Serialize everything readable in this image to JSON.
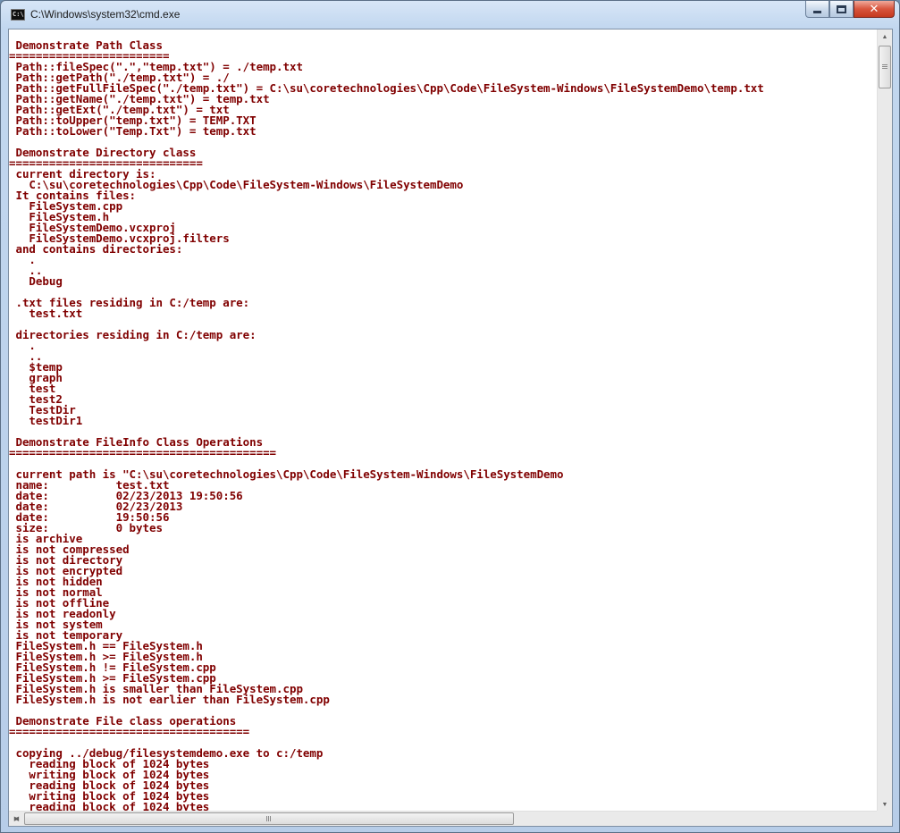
{
  "window": {
    "title": "C:\\Windows\\system32\\cmd.exe",
    "icon": "cmd-icon",
    "icon_text": "C:\\"
  },
  "caption_buttons": {
    "minimize": "minimize-icon",
    "maximize": "maximize-icon",
    "close": "close-icon",
    "close_glyph": "✕"
  },
  "scrollbar": {
    "up_glyph": "▲",
    "down_glyph": "▼",
    "left_glyph": "◀",
    "right_glyph": "▶"
  },
  "console": {
    "text_color": "#800000",
    "background": "#ffffff",
    "lines": [
      " Demonstrate Path Class",
      "========================",
      " Path::fileSpec(\".\",\"temp.txt\") = ./temp.txt",
      " Path::getPath(\"./temp.txt\") = ./",
      " Path::getFullFileSpec(\"./temp.txt\") = C:\\su\\coretechnologies\\Cpp\\Code\\FileSystem-Windows\\FileSystemDemo\\temp.txt",
      " Path::getName(\"./temp.txt\") = temp.txt",
      " Path::getExt(\"./temp.txt\") = txt",
      " Path::toUpper(\"temp.txt\") = TEMP.TXT",
      " Path::toLower(\"Temp.Txt\") = temp.txt",
      "",
      " Demonstrate Directory class",
      "=============================",
      " current directory is:",
      "   C:\\su\\coretechnologies\\Cpp\\Code\\FileSystem-Windows\\FileSystemDemo",
      " It contains files:",
      "   FileSystem.cpp",
      "   FileSystem.h",
      "   FileSystemDemo.vcxproj",
      "   FileSystemDemo.vcxproj.filters",
      " and contains directories:",
      "   .",
      "   ..",
      "   Debug",
      "",
      " .txt files residing in C:/temp are:",
      "   test.txt",
      "",
      " directories residing in C:/temp are:",
      "   .",
      "   ..",
      "   $temp",
      "   graph",
      "   test",
      "   test2",
      "   TestDir",
      "   testDir1",
      "",
      " Demonstrate FileInfo Class Operations",
      "========================================",
      "",
      " current path is \"C:\\su\\coretechnologies\\Cpp\\Code\\FileSystem-Windows\\FileSystemDemo",
      " name:          test.txt",
      " date:          02/23/2013 19:50:56",
      " date:          02/23/2013",
      " date:          19:50:56",
      " size:          0 bytes",
      " is archive",
      " is not compressed",
      " is not directory",
      " is not encrypted",
      " is not hidden",
      " is not normal",
      " is not offline",
      " is not readonly",
      " is not system",
      " is not temporary",
      " FileSystem.h == FileSystem.h",
      " FileSystem.h >= FileSystem.h",
      " FileSystem.h != FileSystem.cpp",
      " FileSystem.h >= FileSystem.cpp",
      " FileSystem.h is smaller than FileSystem.cpp",
      " FileSystem.h is not earlier than FileSystem.cpp",
      "",
      " Demonstrate File class operations",
      "====================================",
      "",
      " copying ../debug/filesystemdemo.exe to c:/temp",
      "   reading block of 1024 bytes",
      "   writing block of 1024 bytes",
      "   reading block of 1024 bytes",
      "   writing block of 1024 bytes",
      "   reading block of 1024 bytes"
    ]
  }
}
